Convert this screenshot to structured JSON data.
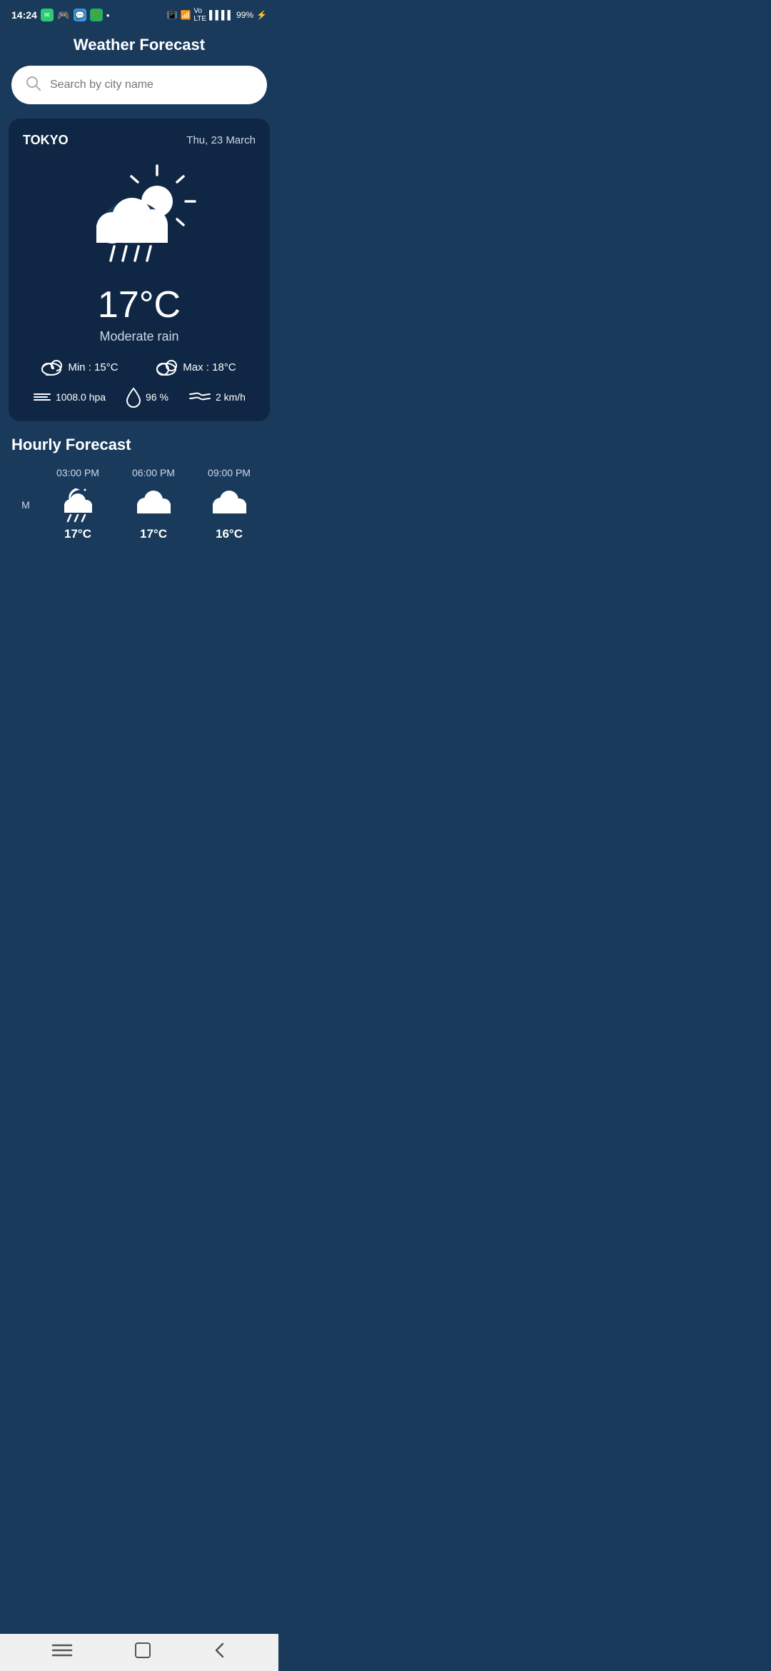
{
  "statusBar": {
    "time": "14:24",
    "battery": "99%",
    "signal": "4"
  },
  "header": {
    "title": "Weather Forecast"
  },
  "search": {
    "placeholder": "Search by city name"
  },
  "weatherCard": {
    "city": "TOKYO",
    "date": "Thu, 23 March",
    "temperature": "17°C",
    "condition": "Moderate rain",
    "min": "Min : 15°C",
    "max": "Max : 18°C",
    "pressure": "1008.0 hpa",
    "humidity": "96 %",
    "wind": "2 km/h"
  },
  "hourlyForecast": {
    "title": "Hourly Forecast",
    "mLabel": "M",
    "hours": [
      {
        "time": "03:00 PM",
        "temp": "17°C",
        "icon": "rainy-night"
      },
      {
        "time": "06:00 PM",
        "temp": "17°C",
        "icon": "cloudy"
      },
      {
        "time": "09:00 PM",
        "temp": "16°C",
        "icon": "cloudy"
      }
    ]
  },
  "navBar": {
    "menu": "☰",
    "home": "□",
    "back": "◁"
  }
}
